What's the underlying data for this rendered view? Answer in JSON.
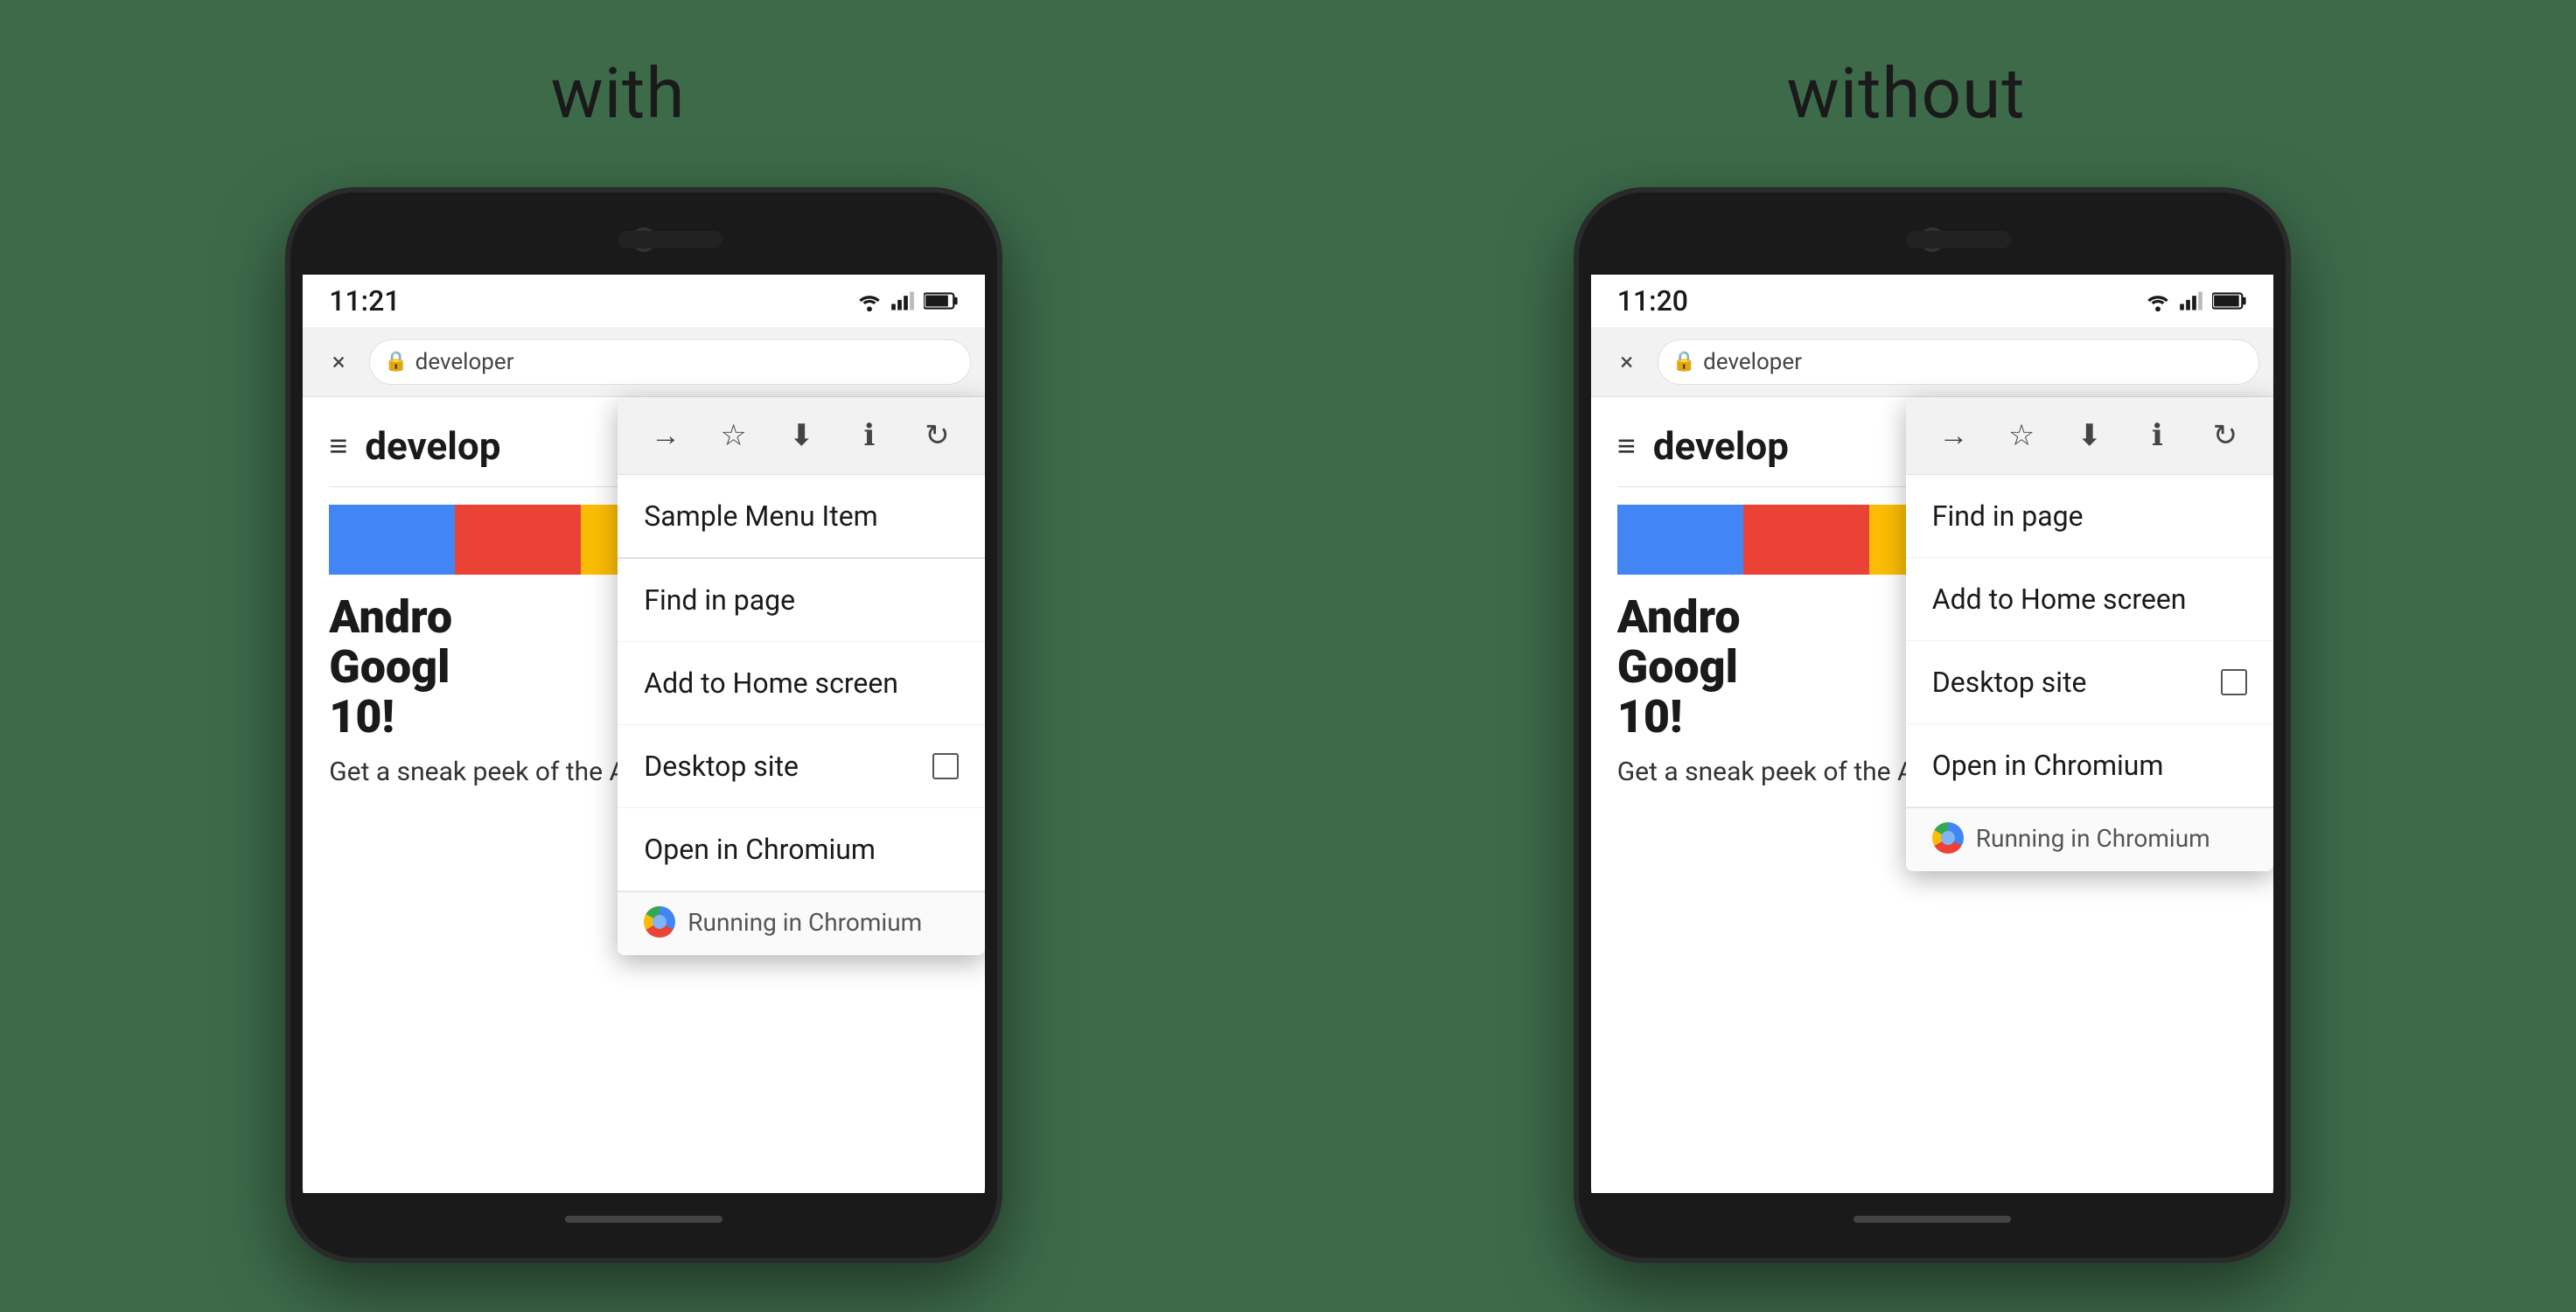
{
  "labels": {
    "with": "with",
    "without": "without"
  },
  "phone_with": {
    "status": {
      "time": "11:21"
    },
    "toolbar": {
      "url": "developer",
      "close": "×"
    },
    "page": {
      "title": "develop",
      "body_title": "Andro\nGoogl\n10!",
      "body_sub": "Get a sneak peek of the Android talks that"
    },
    "dropdown": {
      "sample_item": "Sample Menu Item",
      "find_in_page": "Find in page",
      "add_to_home": "Add to Home screen",
      "desktop_site": "Desktop site",
      "open_in_chromium": "Open in Chromium",
      "running_in_chromium": "Running in Chromium"
    }
  },
  "phone_without": {
    "status": {
      "time": "11:20"
    },
    "toolbar": {
      "url": "developer",
      "close": "×"
    },
    "page": {
      "title": "develop",
      "body_title": "Andro\nGoogl\n10!",
      "body_sub": "Get a sneak peek of the Android talks that"
    },
    "dropdown": {
      "find_in_page": "Find in page",
      "add_to_home": "Add to Home screen",
      "desktop_site": "Desktop site",
      "open_in_chromium": "Open in Chromium",
      "running_in_chromium": "Running in Chromium"
    }
  },
  "color_stripes": [
    "#4285f4",
    "#ea4335",
    "#fbbc04",
    "#34a853",
    "#1a1a1a"
  ]
}
